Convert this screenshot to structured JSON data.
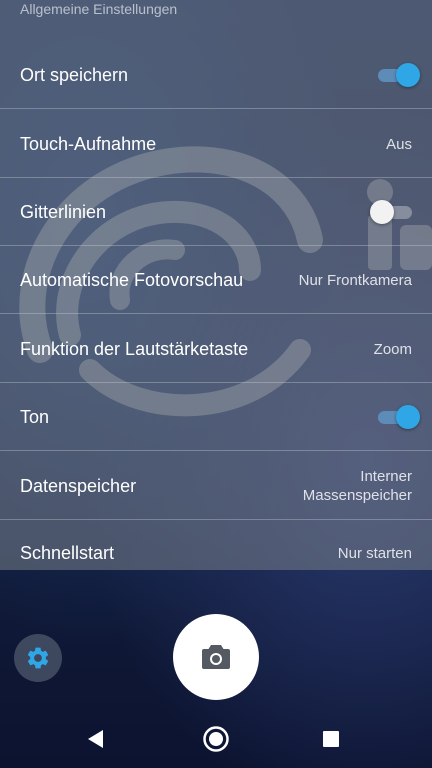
{
  "section_header": "Allgemeine Einstellungen",
  "settings": [
    {
      "label": "Ort speichern",
      "type": "toggle",
      "state": "on"
    },
    {
      "label": "Touch-Aufnahme",
      "type": "value",
      "value": "Aus"
    },
    {
      "label": "Gitterlinien",
      "type": "toggle",
      "state": "off"
    },
    {
      "label": "Automatische Fotovorschau",
      "type": "value",
      "value": "Nur Frontkamera"
    },
    {
      "label": "Funktion der Lautstärketaste",
      "type": "value",
      "value": "Zoom"
    },
    {
      "label": "Ton",
      "type": "toggle",
      "state": "on"
    },
    {
      "label": "Datenspeicher",
      "type": "value",
      "value_line1": "Interner",
      "value_line2": "Massenspeicher"
    },
    {
      "label": "Schnellstart",
      "type": "value",
      "value": "Nur starten"
    }
  ],
  "icons": {
    "gear": "gear-icon",
    "shutter": "camera-icon",
    "back": "back-triangle-icon",
    "home": "home-circle-icon",
    "recents": "recents-square-icon"
  },
  "colors": {
    "toggle_on": "#2fa7e6",
    "gear_icon": "#2fa7e6"
  }
}
